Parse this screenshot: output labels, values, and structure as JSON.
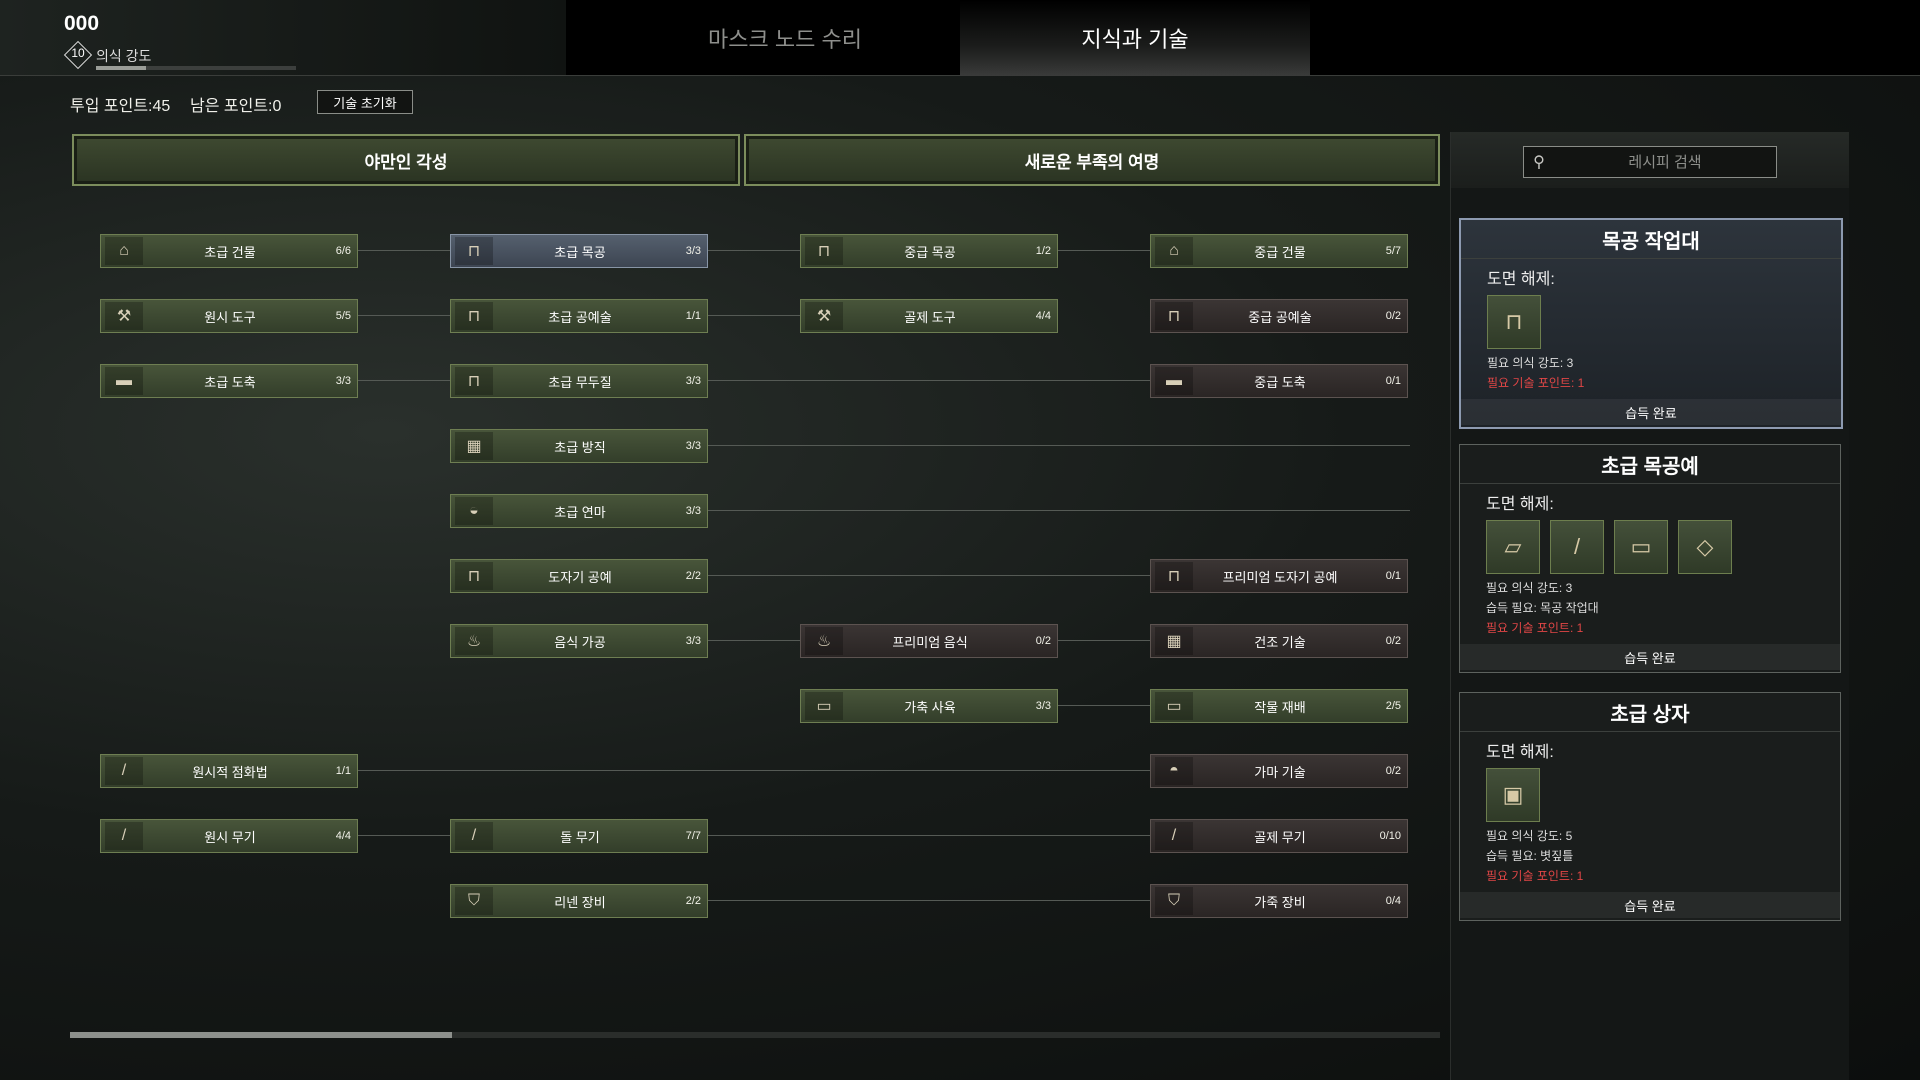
{
  "header": {
    "level_value": "000",
    "level_badge": "10",
    "level_label": "의식 강도",
    "level_progress": 0.25,
    "tabs": [
      {
        "label": "마스크 노드 수리",
        "active": false
      },
      {
        "label": "지식과 기술",
        "active": true
      }
    ]
  },
  "points": {
    "invested": "투입 포인트:45",
    "remaining": "남은 포인트:0",
    "reset_label": "기술 초기화"
  },
  "categories": [
    {
      "label": "야만인 각성"
    },
    {
      "label": "새로운 부족의 여명"
    }
  ],
  "nodes": [
    {
      "name": "초급 건물",
      "count": "6/6",
      "icon": "building-icon",
      "glyph": "⌂"
    },
    {
      "name": "원시 도구",
      "count": "5/5",
      "icon": "axe-icon",
      "glyph": "⚒"
    },
    {
      "name": "초급 도축",
      "count": "3/3",
      "icon": "butcher-table-icon",
      "glyph": "▬"
    },
    {
      "name": "원시적 점화법",
      "count": "1/1",
      "icon": "torch-icon",
      "glyph": "/"
    },
    {
      "name": "원시 무기",
      "count": "4/4",
      "icon": "spear-icon",
      "glyph": "/"
    },
    {
      "name": "초급 목공",
      "count": "3/3",
      "icon": "workbench-icon",
      "glyph": "⊓"
    },
    {
      "name": "초급 공예술",
      "count": "1/1",
      "icon": "craft-table-icon",
      "glyph": "⊓"
    },
    {
      "name": "초급 무두질",
      "count": "3/3",
      "icon": "tanning-rack-icon",
      "glyph": "⊓"
    },
    {
      "name": "초급 방직",
      "count": "3/3",
      "icon": "loom-icon",
      "glyph": "▦"
    },
    {
      "name": "초급 연마",
      "count": "3/3",
      "icon": "grindstone-icon",
      "glyph": "◒"
    },
    {
      "name": "도자기 공예",
      "count": "2/2",
      "icon": "pottery-wheel-icon",
      "glyph": "⊓"
    },
    {
      "name": "음식 가공",
      "count": "3/3",
      "icon": "cooking-pot-icon",
      "glyph": "♨"
    },
    {
      "name": "돌 무기",
      "count": "7/7",
      "icon": "stone-spear-icon",
      "glyph": "/"
    },
    {
      "name": "리넨 장비",
      "count": "2/2",
      "icon": "linen-armor-icon",
      "glyph": "⛉"
    },
    {
      "name": "중급 목공",
      "count": "1/2",
      "icon": "workbench-icon",
      "glyph": "⊓"
    },
    {
      "name": "골제 도구",
      "count": "4/4",
      "icon": "pickaxe-icon",
      "glyph": "⚒"
    },
    {
      "name": "프리미엄 음식",
      "count": "0/2",
      "icon": "cooking-pot-icon",
      "glyph": "♨"
    },
    {
      "name": "가축 사육",
      "count": "3/3",
      "icon": "trough-icon",
      "glyph": "▭"
    },
    {
      "name": "중급 건물",
      "count": "5/7",
      "icon": "building-icon",
      "glyph": "⌂"
    },
    {
      "name": "중급 공예술",
      "count": "0/2",
      "icon": "craft-table-icon",
      "glyph": "⊓"
    },
    {
      "name": "중급 도축",
      "count": "0/1",
      "icon": "butcher-table-icon",
      "glyph": "▬"
    },
    {
      "name": "프리미엄 도자기 공예",
      "count": "0/1",
      "icon": "pottery-wheel-icon",
      "glyph": "⊓"
    },
    {
      "name": "건조 기술",
      "count": "0/2",
      "icon": "drying-rack-icon",
      "glyph": "▦"
    },
    {
      "name": "작물 재배",
      "count": "2/5",
      "icon": "crop-planter-icon",
      "glyph": "▭"
    },
    {
      "name": "가마 기술",
      "count": "0/2",
      "icon": "kiln-icon",
      "glyph": "◓"
    },
    {
      "name": "골제 무기",
      "count": "0/10",
      "icon": "bone-spear-icon",
      "glyph": "/"
    },
    {
      "name": "가죽 장비",
      "count": "0/4",
      "icon": "leather-armor-icon",
      "glyph": "⛉"
    }
  ],
  "scrollbar": {
    "position": 0.28
  },
  "sidebar": {
    "search_placeholder": "레시피 검색",
    "cards": [
      {
        "title": "목공 작업대",
        "subtitle": "도면 해제:",
        "items": [
          "workbench-icon"
        ],
        "req_level": "필요 의식 강도: 3",
        "req_learn": "",
        "req_points": "필요 기술 포인트: 1",
        "status": "습득 완료"
      },
      {
        "title": "초급 목공예",
        "subtitle": "도면 해제:",
        "items": [
          "wood-plank-icon",
          "wooden-stick-icon",
          "wood-board-icon",
          "wood-shield-icon"
        ],
        "req_level": "필요 의식 강도: 3",
        "req_learn": "습득 필요: 목공 작업대",
        "req_points": "필요 기술 포인트: 1",
        "status": "습득 완료"
      },
      {
        "title": "초급 상자",
        "subtitle": "도면 해제:",
        "items": [
          "wooden-crate-icon"
        ],
        "req_level": "필요 의식 강도: 5",
        "req_learn": "습득 필요: 볏짚틀",
        "req_points": "필요 기술 포인트: 1",
        "status": "습득 완료"
      }
    ]
  },
  "colors": {
    "node_green": "#48553a",
    "node_selected": "#55606e",
    "node_locked": "#3b3534",
    "requirement_red": "#e04646"
  }
}
